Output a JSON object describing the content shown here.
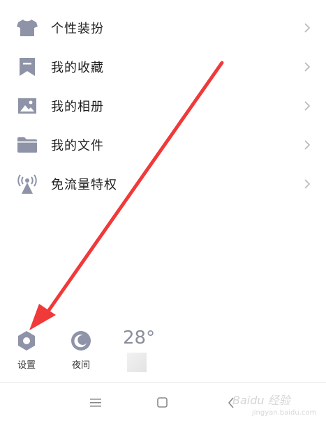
{
  "menu": {
    "items": [
      {
        "label": "个性装扮",
        "icon": "tshirt-icon"
      },
      {
        "label": "我的收藏",
        "icon": "bookmark-icon"
      },
      {
        "label": "我的相册",
        "icon": "photo-icon"
      },
      {
        "label": "我的文件",
        "icon": "folder-icon"
      },
      {
        "label": "免流量特权",
        "icon": "signal-tower-icon"
      }
    ]
  },
  "tools": {
    "settings_label": "设置",
    "night_label": "夜间"
  },
  "weather": {
    "temperature": "28°"
  },
  "watermark": {
    "brand": "Baidu 经验",
    "url": "jingyan.baidu.com"
  },
  "colors": {
    "icon": "#8e93a8",
    "chevron": "#b8b8b8",
    "annotation_arrow": "#f03a3a"
  }
}
